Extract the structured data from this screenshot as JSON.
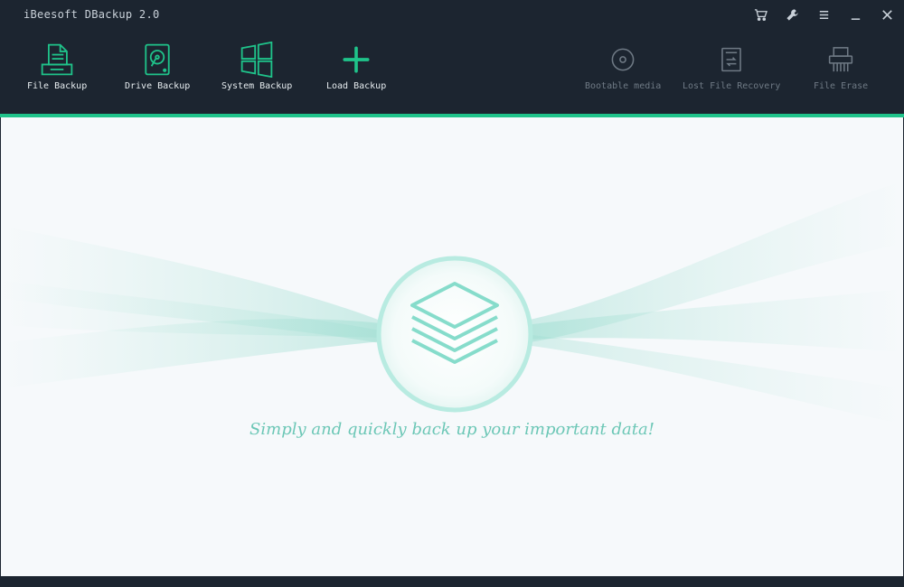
{
  "app": {
    "title": "iBeesoft DBackup 2.0"
  },
  "window_controls": [
    {
      "name": "cart-icon"
    },
    {
      "name": "wrench-icon"
    },
    {
      "name": "menu-icon"
    },
    {
      "name": "minimize-icon"
    },
    {
      "name": "close-icon"
    }
  ],
  "toolbar": {
    "primary": [
      {
        "label": "File Backup",
        "icon": "file-backup-icon"
      },
      {
        "label": "Drive Backup",
        "icon": "drive-backup-icon"
      },
      {
        "label": "System Backup",
        "icon": "system-backup-icon"
      },
      {
        "label": "Load Backup",
        "icon": "plus-icon"
      }
    ],
    "secondary": [
      {
        "label": "Bootable media",
        "icon": "disc-icon"
      },
      {
        "label": "Lost File Recovery",
        "icon": "file-recovery-icon"
      },
      {
        "label": "File Erase",
        "icon": "shredder-icon"
      }
    ]
  },
  "main": {
    "tagline": "Simply and quickly back up your important data!",
    "center_icon": "layers-icon"
  },
  "colors": {
    "accent": "#1fc38a",
    "topbar": "#1c2530",
    "tagline": "#6cc7b6"
  }
}
